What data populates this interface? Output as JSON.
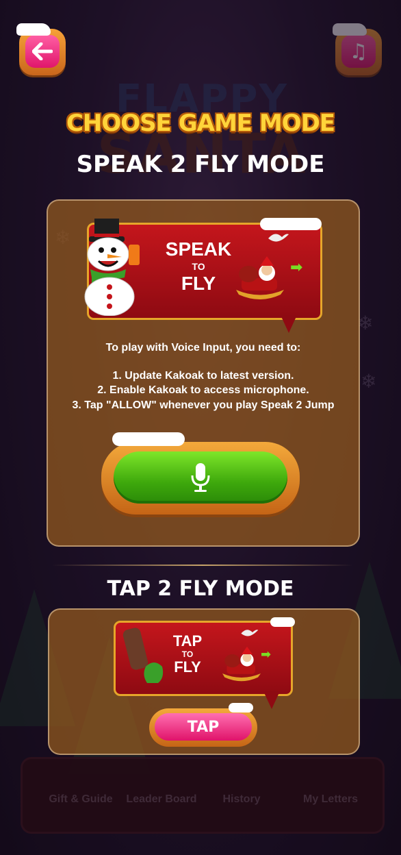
{
  "header": {
    "back_icon": "arrow-left-icon",
    "music_icon": "music-note-icon",
    "choose_title": "CHOOSE GAME MODE"
  },
  "background": {
    "logo_line1": "FLAPPY",
    "logo_line2": "SANTA",
    "nav": [
      "Gift & Guide",
      "Leader Board",
      "History",
      "My Letters"
    ]
  },
  "speak_mode": {
    "title": "SPEAK 2 FLY MODE",
    "banner": {
      "line1": "SPEAK",
      "line2": "TO",
      "line3": "FLY"
    },
    "info_heading": "To play with Voice Input, you need to:",
    "steps": [
      "1. Update Kakoak to latest version.",
      "2. Enable Kakoak to access microphone.",
      "3. Tap \"ALLOW\" whenever you play Speak 2 Jump"
    ],
    "button_icon": "microphone-icon",
    "accent": "#4cbc14"
  },
  "tap_mode": {
    "title": "TAP 2 FLY MODE",
    "banner": {
      "line1": "TAP",
      "line2": "TO",
      "line3": "FLY"
    },
    "button_label": "TAP",
    "accent": "#e8197a"
  }
}
